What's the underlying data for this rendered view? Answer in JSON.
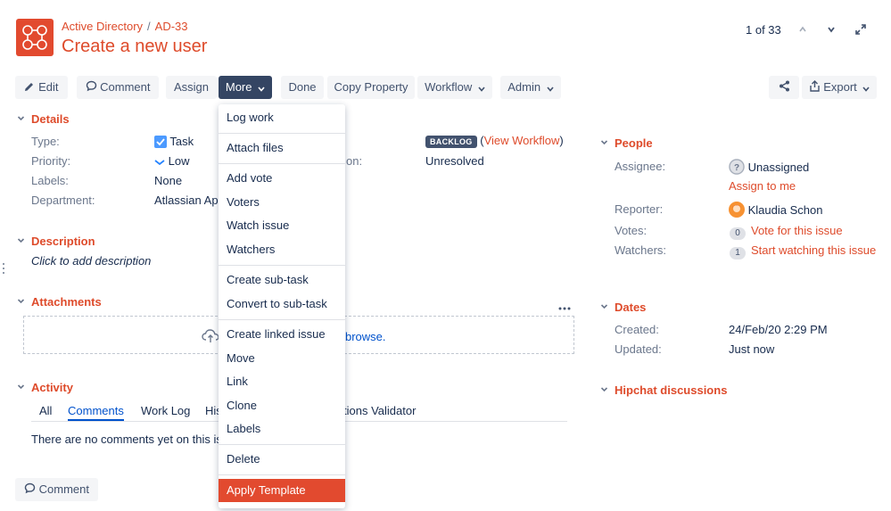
{
  "header": {
    "project": "Active Directory",
    "separator": "/",
    "issue_key": "AD-33",
    "title": "Create a new user",
    "pager": "1 of 33"
  },
  "toolbar": {
    "edit": "Edit",
    "comment": "Comment",
    "assign": "Assign",
    "more": "More",
    "done": "Done",
    "copy_property": "Copy Property",
    "workflow": "Workflow",
    "admin": "Admin",
    "export": "Export"
  },
  "details": {
    "heading": "Details",
    "type_label": "Type:",
    "type_value": "Task",
    "priority_label": "Priority:",
    "priority_value": "Low",
    "labels_label": "Labels:",
    "labels_value": "None",
    "department_label": "Department:",
    "department_value": "Atlassian App",
    "status_badge": "BACKLOG",
    "view_workflow_open": "(",
    "view_workflow": "View Workflow",
    "view_workflow_close": ")",
    "resolution_label_fragment": "on:",
    "resolution_value": "Unresolved"
  },
  "description": {
    "heading": "Description",
    "placeholder": "Click to add description"
  },
  "attachments": {
    "heading": "Attachments",
    "browse_fragment": "browse."
  },
  "activity": {
    "heading": "Activity",
    "tabs": [
      "All",
      "Comments",
      "Work Log",
      "His",
      "tions Validator"
    ],
    "empty_text": "There are no comments yet on this is",
    "comment_button": "Comment"
  },
  "more_menu": {
    "items": [
      "Log work",
      "Attach files",
      "Add vote",
      "Voters",
      "Watch issue",
      "Watchers",
      "Create sub-task",
      "Convert to sub-task",
      "Create linked issue",
      "Move",
      "Link",
      "Clone",
      "Labels",
      "Delete",
      "Apply Template"
    ]
  },
  "people": {
    "heading": "People",
    "assignee_label": "Assignee:",
    "assignee_value": "Unassigned",
    "assign_to_me": "Assign to me",
    "reporter_label": "Reporter:",
    "reporter_value": "Klaudia Schon",
    "votes_label": "Votes:",
    "votes_count": "0",
    "vote_link": "Vote for this issue",
    "watchers_label": "Watchers:",
    "watchers_count": "1",
    "watch_link": "Start watching this issue"
  },
  "dates": {
    "heading": "Dates",
    "created_label": "Created:",
    "created_value": "24/Feb/20 2:29 PM",
    "updated_label": "Updated:",
    "updated_value": "Just now"
  },
  "hipchat": {
    "heading": "Hipchat discussions"
  },
  "colors": {
    "accent": "#de4b2b",
    "toolbar_active": "#344563",
    "highlight": "#e24a2f"
  }
}
